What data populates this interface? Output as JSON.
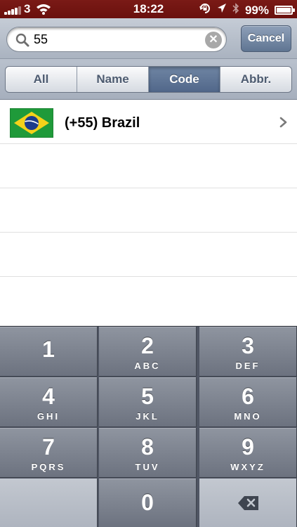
{
  "status_bar": {
    "carrier": "3",
    "time": "18:22",
    "battery_percent": "99%",
    "battery_level": 0.99,
    "icons": [
      "signal-icon",
      "wifi-icon",
      "rotation-lock-icon",
      "location-arrow-icon",
      "bluetooth-icon",
      "battery-icon"
    ]
  },
  "search": {
    "query": "55",
    "cancel_label": "Cancel"
  },
  "filters": {
    "segments": [
      {
        "label": "All",
        "active": false
      },
      {
        "label": "Name",
        "active": false
      },
      {
        "label": "Code",
        "active": true
      },
      {
        "label": "Abbr.",
        "active": false
      }
    ]
  },
  "results": [
    {
      "label": "(+55) Brazil",
      "flag": "brazil-flag-icon"
    }
  ],
  "keypad": {
    "keys": [
      {
        "num": "1",
        "letters": ""
      },
      {
        "num": "2",
        "letters": "ABC"
      },
      {
        "num": "3",
        "letters": "DEF"
      },
      {
        "num": "4",
        "letters": "GHI"
      },
      {
        "num": "5",
        "letters": "JKL"
      },
      {
        "num": "6",
        "letters": "MNO"
      },
      {
        "num": "7",
        "letters": "PQRS"
      },
      {
        "num": "8",
        "letters": "TUV"
      },
      {
        "num": "9",
        "letters": "WXYZ"
      },
      {
        "num": "0",
        "letters": ""
      }
    ],
    "delete_icon": "backspace-icon"
  },
  "colors": {
    "status_bar": "#6e120f",
    "segment_active": "#5a6f90",
    "cancel_button": "#6c7f9c",
    "keypad": "#787e8a"
  }
}
